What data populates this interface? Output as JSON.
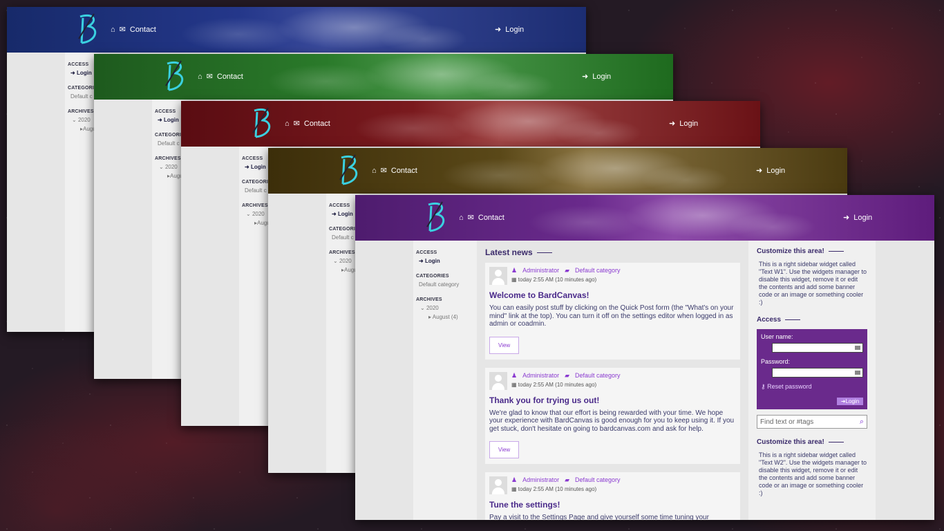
{
  "nav": {
    "contact": "Contact",
    "login": "Login"
  },
  "left_sidebar": {
    "access_title": "ACCESS",
    "login": "Login",
    "categories_title": "CATEGORIES",
    "default_category": "Default category",
    "archives_title": "ARCHIVES",
    "year": "2020",
    "month": "August (4)"
  },
  "left_sidebar_truncated": {
    "default_category": "Default c",
    "month": "Augu",
    "year": "2020",
    "categories_title": "CATEGORIE"
  },
  "main": {
    "section_title": "Latest news",
    "posts": [
      {
        "author": "Administrator",
        "category": "Default category",
        "time": "today 2:55 AM (10 minutes ago)",
        "title": "Welcome to BardCanvas!",
        "body": "You can easily post stuff by clicking on the Quick Post form (the \"What's on your mind\" link at the top). You can turn it off on the settings editor when logged in as admin or coadmin.",
        "button": "View"
      },
      {
        "author": "Administrator",
        "category": "Default category",
        "time": "today 2:55 AM (10 minutes ago)",
        "title": "Thank you for trying us out!",
        "body": "We're glad to know that our effort is being rewarded with your time. We hope your experience with BardCanvas is good enough for you to keep using it. If you get stuck, don't hesitate on going to bardcanvas.com and ask for help.",
        "button": "View"
      },
      {
        "author": "Administrator",
        "category": "Default category",
        "time": "today 2:55 AM (10 minutes ago)",
        "title": "Tune the settings!",
        "body": "Pay a visit to the Settings Page and give yourself some time tuning your"
      }
    ]
  },
  "right_sidebar": {
    "widget1_title": "Customize this area!",
    "widget1_text": "This is a right sidebar widget called \"Text W1\". Use the widgets manager to disable this widget, remove it or edit the contents and add some banner code or an image or something cooler :)",
    "access_title": "Access",
    "username_label": "User name:",
    "password_label": "Password:",
    "reset_password": "Reset password",
    "login_button": "Login",
    "search_placeholder": "Find text or #tags",
    "widget2_title": "Customize this area!",
    "widget2_text": "This is a right sidebar widget called \"Text W2\". Use the widgets manager to disable this widget, remove it or edit the contents and add some banner code or an image or something cooler :)"
  },
  "themes": [
    "blue",
    "green",
    "red",
    "gold",
    "purple"
  ]
}
